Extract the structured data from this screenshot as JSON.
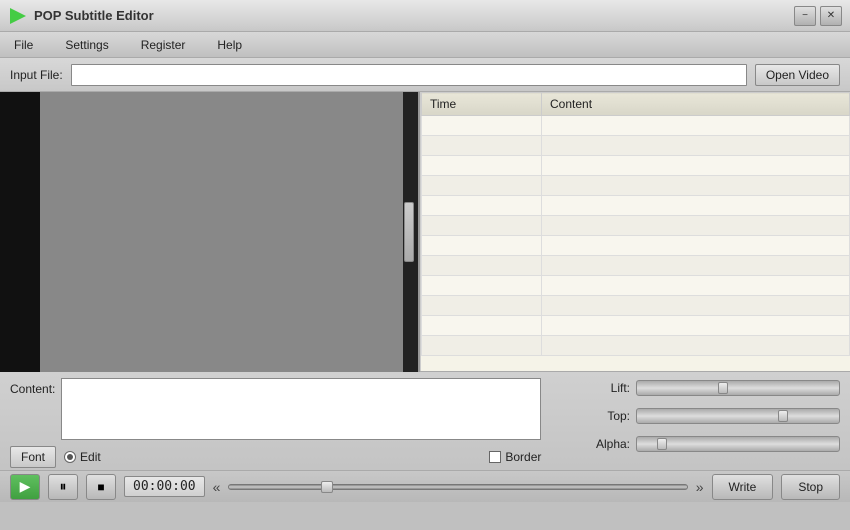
{
  "titleBar": {
    "logo": "▶",
    "appName": "POP  Subtitle Editor",
    "minimizeLabel": "−",
    "closeLabel": "✕"
  },
  "menuBar": {
    "items": [
      "File",
      "Settings",
      "Register",
      "Help"
    ]
  },
  "inputFile": {
    "label": "Input File:",
    "placeholder": "",
    "openVideoLabel": "Open Video"
  },
  "subtitleTable": {
    "columns": [
      "Time",
      "Content"
    ],
    "rows": []
  },
  "bottomControls": {
    "contentLabel": "Content:",
    "fontLabel": "Font",
    "editLabel": "Edit",
    "borderLabel": "Border",
    "sliders": [
      {
        "label": "Lift:",
        "thumbLeft": "40%"
      },
      {
        "label": "Top:",
        "thumbLeft": "70%"
      },
      {
        "label": "Alpha:",
        "thumbLeft": "15%"
      }
    ]
  },
  "transport": {
    "playLabel": "▶",
    "pauseLabel": "⏸",
    "stopLabel": "■",
    "timeDisplay": "00:00:00",
    "seekBackLabel": "«",
    "seekForwardLabel": "»",
    "writeLabel": "Write",
    "stopBtnLabel": "Stop"
  }
}
